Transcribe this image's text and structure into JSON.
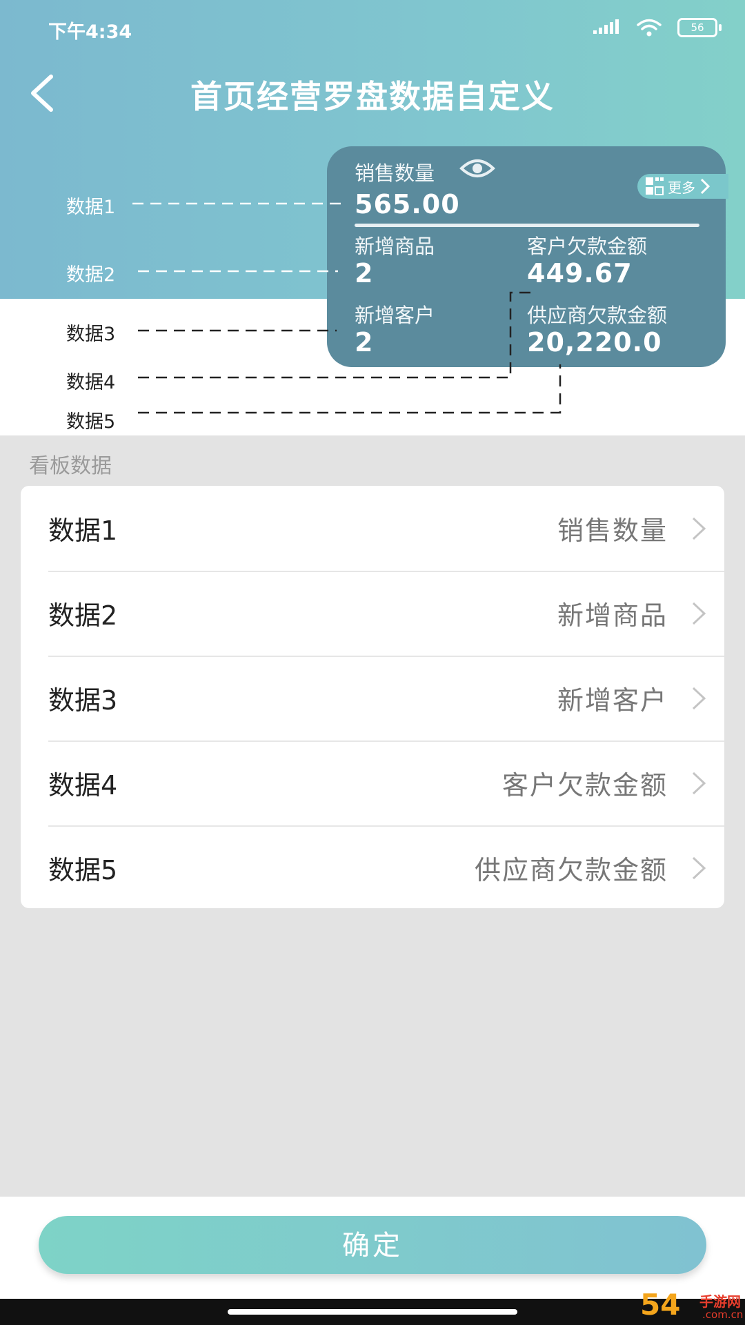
{
  "status_bar": {
    "time": "下午4:34",
    "battery": "56"
  },
  "header": {
    "title": "首页经营罗盘数据自定义"
  },
  "preview_card": {
    "main": {
      "label": "销售数量",
      "value": "565.00"
    },
    "more_label": "更多",
    "cells": [
      {
        "label": "新增商品",
        "value": "2"
      },
      {
        "label": "客户欠款金额",
        "value": "449.67"
      },
      {
        "label": "新增客户",
        "value": "2"
      },
      {
        "label": "供应商欠款金额",
        "value": "20,220.0"
      }
    ]
  },
  "annotations": [
    "数据1",
    "数据2",
    "数据3",
    "数据4",
    "数据5"
  ],
  "section_label": "看板数据",
  "rows": [
    {
      "name": "数据1",
      "value": "销售数量"
    },
    {
      "name": "数据2",
      "value": "新增商品"
    },
    {
      "name": "数据3",
      "value": "新增客户"
    },
    {
      "name": "数据4",
      "value": "客户欠款金额"
    },
    {
      "name": "数据5",
      "value": "供应商欠款金额"
    }
  ],
  "confirm_label": "确定",
  "watermark": {
    "number": "54",
    "text": "手游网",
    "sub": ".com.cn"
  }
}
